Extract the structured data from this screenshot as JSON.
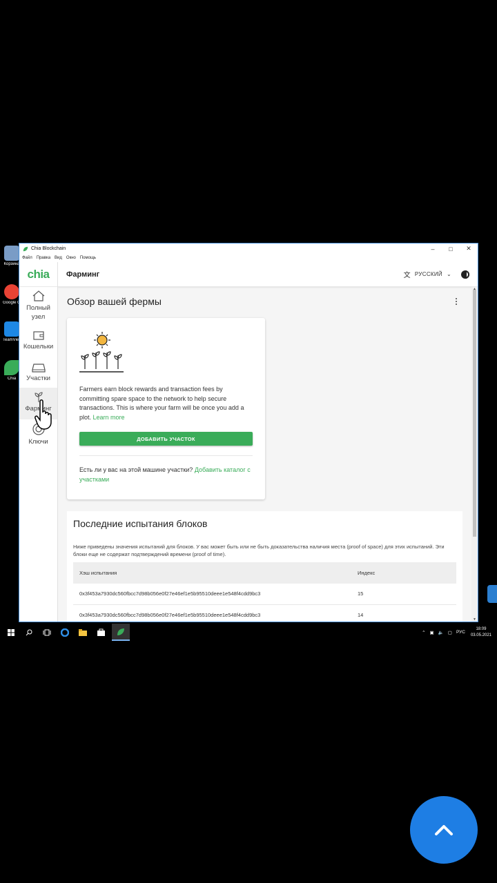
{
  "desktop_icons": [
    {
      "label": "Корзина",
      "color": "#7a9cc6"
    },
    {
      "label": "Google Chrome",
      "color": "#e94335"
    },
    {
      "label": "TeamViewer",
      "color": "#1e88e5"
    },
    {
      "label": "Chia",
      "color": "#3aac59"
    }
  ],
  "window": {
    "title": "Chia Blockchain",
    "menu": [
      "Файл",
      "Правка",
      "Вид",
      "Окно",
      "Помощь"
    ]
  },
  "sidebar": {
    "logo": "chia",
    "items": [
      {
        "label": "Полный узел",
        "icon": "home-icon"
      },
      {
        "label": "Кошельки",
        "icon": "wallet-icon"
      },
      {
        "label": "Участки",
        "icon": "drive-icon"
      },
      {
        "label": "Фарминг",
        "icon": "sprout-icon",
        "active": true
      },
      {
        "label": "Ключи",
        "icon": "lifebuoy-icon"
      }
    ]
  },
  "topbar": {
    "page_title": "Фарминг",
    "language": "РУССКИЙ"
  },
  "farm": {
    "heading": "Обзор вашей фермы",
    "description": "Farmers earn block rewards and transaction fees by committing spare space to the network to help secure transactions. This is where your farm will be once you add a plot.",
    "learn_more": "Learn more",
    "add_button": "ДОБАВИТЬ УЧАСТОК",
    "help_text": "Есть ли у вас на этой машине участки?",
    "help_link": "Добавить каталог с участками"
  },
  "challenges": {
    "heading": "Последние испытания блоков",
    "note": "Ниже приведены значения испытаний для блоков. У вас может быть или не быть доказательства наличия места (proof of space) для этих испытаний. Эти блоки еще не содержат подтверждений времени (proof of time).",
    "columns": [
      "Хэш испытания",
      "Индекс"
    ],
    "rows": [
      {
        "hash": "0x3f453a7930dc560fbcc7d98b056e0f27e46ef1e5b95510deee1e548f4cdd9bc3",
        "index": "15"
      },
      {
        "hash": "0x3f453a7930dc560fbcc7d98b056e0f27e46ef1e5b95510deee1e548f4cdd9bc3",
        "index": "14"
      }
    ]
  },
  "taskbar": {
    "lang": "РУС",
    "time": "18:09",
    "date": "03.05.2021"
  },
  "colors": {
    "accent": "#3aac59",
    "fab": "#1e7ee4"
  }
}
